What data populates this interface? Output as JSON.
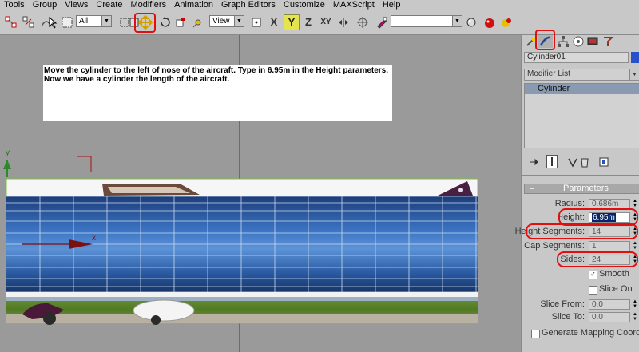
{
  "menu": [
    "Tools",
    "Group",
    "Views",
    "Create",
    "Modifiers",
    "Animation",
    "Graph Editors",
    "Customize",
    "MAXScript",
    "Help"
  ],
  "toolbar": {
    "selection_filter": "All",
    "coord_system": "View",
    "axis_x": "X",
    "axis_y": "Y",
    "axis_z": "Z",
    "axis_xy": "XY",
    "move_tool_highlighted": true
  },
  "viewport": {
    "axis_label": "y",
    "gizmo_label": "x"
  },
  "instructions": {
    "line1": "Move the cylinder to the left of nose of the aircraft.  Type in 6.95m in the Height parameters.",
    "line2": "Now we have a cylinder the length of the aircraft."
  },
  "command_panel": {
    "object_name": "Cylinder01",
    "modifier_list": "Modifier List",
    "stack_item": "Cylinder",
    "rollout_toggle": "–",
    "rollout_title": "Parameters",
    "params": {
      "radius_label": "Radius:",
      "radius_value": "0.686m",
      "height_label": "Height:",
      "height_value": "6.95m",
      "height_segments_label": "Height Segments:",
      "height_segments_value": "14",
      "cap_segments_label": "Cap Segments:",
      "cap_segments_value": "1",
      "sides_label": "Sides:",
      "sides_value": "24",
      "smooth_label": "Smooth",
      "smooth_checked": true,
      "slice_on_label": "Slice On",
      "slice_on_checked": false,
      "slice_from_label": "Slice From:",
      "slice_from_value": "0.0",
      "slice_to_label": "Slice To:",
      "slice_to_value": "0.0",
      "gen_mapping_label": "Generate Mapping Coords"
    }
  },
  "colors": {
    "highlight": "#e01010",
    "cylinder_blue": "#2a5fa8",
    "selection_green": "#7cc242",
    "panel_bg": "#c8c8c8",
    "viewport_bg": "#9a9a9a"
  }
}
